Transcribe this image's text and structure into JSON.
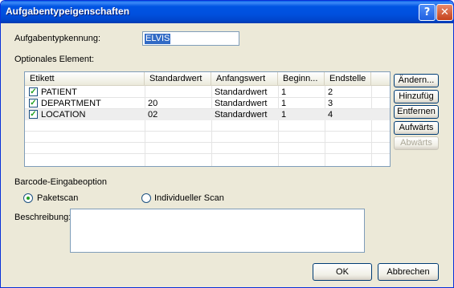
{
  "window": {
    "title": "Aufgabentypeigenschaften",
    "help_label": "?",
    "close_label": "✕"
  },
  "task_type": {
    "label": "Aufgabentypkennung:",
    "value": "ELVIS"
  },
  "optional_element": {
    "label": "Optionales Element:",
    "columns": [
      "Etikett",
      "Standardwert",
      "Anfangswert",
      "Beginn...",
      "Endstelle"
    ],
    "rows": [
      {
        "checked": true,
        "label": "PATIENT",
        "default": "",
        "initial": "Standardwert",
        "start": "1",
        "end": "2"
      },
      {
        "checked": true,
        "label": "DEPARTMENT",
        "default": "20",
        "initial": "Standardwert",
        "start": "1",
        "end": "3"
      },
      {
        "checked": true,
        "label": "LOCATION",
        "default": "02",
        "initial": "Standardwert",
        "start": "1",
        "end": "4"
      }
    ],
    "buttons": {
      "edit": "Ändern...",
      "add": "Hinzufüg",
      "remove": "Entfernen",
      "up": "Aufwärts",
      "down": "Abwärts"
    }
  },
  "barcode": {
    "label": "Barcode-Eingabeoption",
    "options": [
      {
        "label": "Paketscan",
        "selected": true
      },
      {
        "label": "Individueller Scan",
        "selected": false
      }
    ]
  },
  "description": {
    "label": "Beschreibung:",
    "value": ""
  },
  "footer": {
    "ok": "OK",
    "cancel": "Abbrechen"
  }
}
